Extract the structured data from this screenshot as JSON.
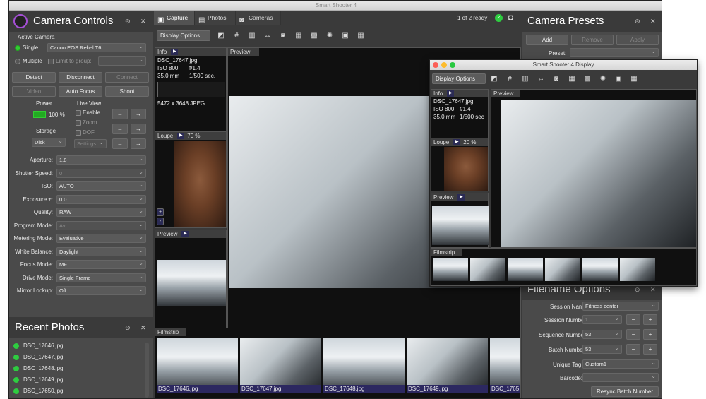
{
  "window": {
    "title": "Smart Shooter 4"
  },
  "left": {
    "title": "Camera Controls",
    "active_camera": {
      "label": "Active Camera",
      "single": "Single",
      "camera": "Canon EOS Rebel T6",
      "multiple": "Multiple",
      "limit": "Limit to group:"
    },
    "buttons": {
      "detect": "Detect",
      "disconnect": "Disconnect",
      "connect": "Connect",
      "video": "Video",
      "autofocus": "Auto Focus",
      "shoot": "Shoot"
    },
    "power": {
      "label": "Power",
      "value": "100 %"
    },
    "liveview": {
      "label": "Live View",
      "enable": "Enable",
      "zoom": "Zoom",
      "dof": "DOF",
      "settings": "Settings"
    },
    "storage": {
      "label": "Storage",
      "value": "Disk"
    },
    "settings": [
      {
        "label": "Aperture:",
        "value": "1.8",
        "disabled": false
      },
      {
        "label": "Shutter Speed:",
        "value": "0",
        "disabled": true
      },
      {
        "label": "ISO:",
        "value": "AUTO",
        "disabled": false
      },
      {
        "label": "Exposure ±:",
        "value": "0.0",
        "disabled": false
      },
      {
        "label": "Quality:",
        "value": "RAW",
        "disabled": false
      },
      {
        "label": "Program Mode:",
        "value": "Av",
        "disabled": true
      },
      {
        "label": "Metering Mode:",
        "value": "Evaluative",
        "disabled": false
      },
      {
        "label": "White Balance:",
        "value": "Daylight",
        "disabled": false
      },
      {
        "label": "Focus Mode:",
        "value": "MF",
        "disabled": false
      },
      {
        "label": "Drive Mode:",
        "value": "Single Frame",
        "disabled": false
      },
      {
        "label": "Mirror Lockup:",
        "value": "Off",
        "disabled": false
      }
    ],
    "recent_title": "Recent Photos",
    "recent": [
      "DSC_17646.jpg",
      "DSC_17647.jpg",
      "DSC_17648.jpg",
      "DSC_17649.jpg",
      "DSC_17650.jpg"
    ]
  },
  "center": {
    "tabs": [
      "Capture",
      "Photos",
      "Cameras"
    ],
    "status": "1 of 2 ready",
    "display_options": "Display Options",
    "info": {
      "title": "Info",
      "file": "DSC_17647.jpg",
      "iso": "ISO 800",
      "fstop": "f/1.4",
      "focal": "35.0 mm",
      "shutter": "1/500 sec.",
      "dims": "5472 x 3648 JPEG"
    },
    "loupe": {
      "title": "Loupe",
      "zoom": "70 %"
    },
    "preview_title": "Preview",
    "filmstrip_title": "Filmstrip",
    "filmstrip": [
      "DSC_17646.jpg",
      "DSC_17647.jpg",
      "DSC_17648.jpg",
      "DSC_17649.jpg",
      "DSC_1765"
    ]
  },
  "right": {
    "title": "Camera Presets",
    "add": "Add",
    "remove": "Remove",
    "apply": "Apply",
    "preset_label": "Preset:",
    "filename_title": "Filename Options",
    "session_name_label": "Session Name:",
    "session_name": "Fitness center",
    "session_number_label": "Session Number:",
    "session_number": "1",
    "sequence_number_label": "Sequence Number:",
    "sequence_number": "53",
    "batch_number_label": "Batch Number:",
    "batch_number": "53",
    "unique_tag_label": "Unique Tag:",
    "unique_tag": "Custom1",
    "barcode_label": "Barcode:",
    "barcode": "",
    "resync": "Resync Batch Number",
    "minus": "−",
    "plus": "+"
  },
  "display": {
    "title": "Smart Shooter 4 Display",
    "display_options": "Display Options",
    "info": {
      "title": "Info",
      "file": "DSC_17647.jpg",
      "iso": "ISO 800",
      "fstop": "f/1.4",
      "focal": "35.0 mm",
      "shutter": "1/500 sec"
    },
    "loupe": {
      "title": "Loupe",
      "zoom": "20 %"
    },
    "preview_title": "Preview",
    "filmstrip_title": "Filmstrip"
  },
  "colors": {
    "accent": "#2ecc40",
    "caption": "#2c2860",
    "panel": "#4a4a4a"
  }
}
